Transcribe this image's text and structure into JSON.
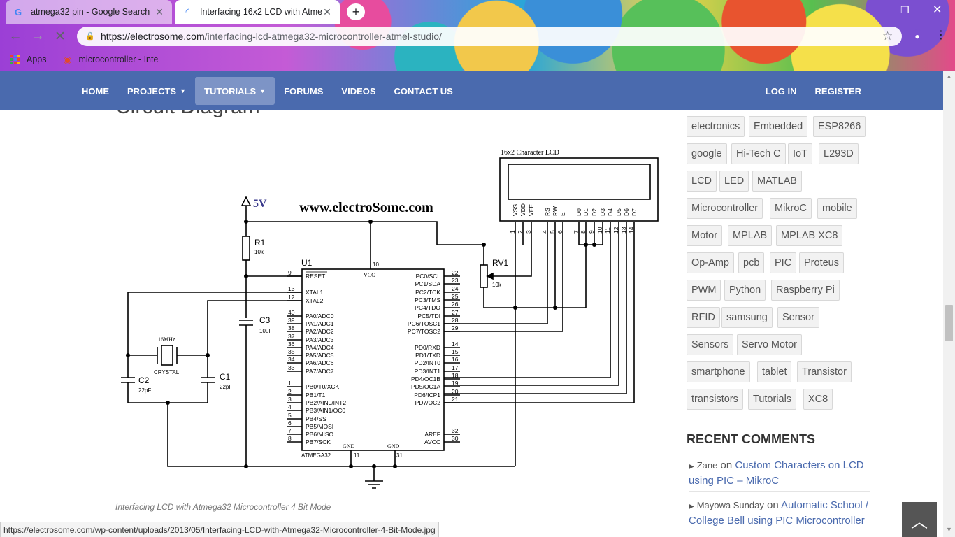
{
  "browser": {
    "tabs": [
      {
        "title": "atmega32 pin - Google Search",
        "favicon": "google-g-icon"
      },
      {
        "title": "Interfacing 16x2 LCD with Atmeg",
        "favicon": "loading-icon"
      }
    ],
    "new_tab": "+",
    "url_host": "https://electrosome.com",
    "url_path": "/interfacing-lcd-atmega32-microcontroller-atmel-studio/",
    "bookmarks": [
      {
        "label": "Apps",
        "icon": "apps-grid-icon"
      },
      {
        "label": "microcontroller - Inte",
        "icon": "site-favicon"
      }
    ],
    "status_url": "https://electrosome.com/wp-content/uploads/2013/05/Interfacing-LCD-with-Atmega32-Microcontroller-4-Bit-Mode.jpg",
    "profile_initial": "●"
  },
  "nav": {
    "items": [
      {
        "label": "HOME"
      },
      {
        "label": "PROJECTS",
        "caret": "▼"
      },
      {
        "label": "TUTORIALS",
        "caret": "▼",
        "active": true
      },
      {
        "label": "FORUMS"
      },
      {
        "label": "VIDEOS"
      },
      {
        "label": "CONTACT US"
      }
    ],
    "right": [
      {
        "label": "LOG IN"
      },
      {
        "label": "REGISTER"
      }
    ]
  },
  "content": {
    "title": "Circuit Diagram",
    "caption": "Interfacing LCD with Atmega32 Microcontroller 4 Bit Mode"
  },
  "diagram": {
    "lcd_label": "16x2 Character LCD",
    "watermark": "www.electroSome.com",
    "vcc_label": "5V",
    "lcd_pins": [
      "VSS",
      "VDD",
      "VEE",
      "RS",
      "RW",
      "E",
      "D0",
      "D1",
      "D2",
      "D3",
      "D4",
      "D5",
      "D6",
      "D7"
    ],
    "lcd_pin_numbers": [
      "1",
      "2",
      "3",
      "4",
      "5",
      "6",
      "7",
      "8",
      "9",
      "10",
      "11",
      "12",
      "13",
      "14"
    ],
    "r1": "R1",
    "r1_value": "10k",
    "rv1": "RV1",
    "rv1_value": "10k",
    "c3": "C3",
    "c3_value": "10uF",
    "c1": "C1",
    "c1_value": "22pF",
    "c2": "C2",
    "c2_value": "22pF",
    "crystal_freq": "16MHz",
    "crystal": "CRYSTAL",
    "u1": "U1",
    "chip": "ATMEGA32",
    "vcc_pin": "VCC",
    "vcc_pin_num": "10",
    "gnd": "GND",
    "gnd_pin_1": "11",
    "gnd_pin_2": "31",
    "left_pins": [
      {
        "num": "9",
        "name": "RESET"
      },
      {
        "num": "13",
        "name": "XTAL1"
      },
      {
        "num": "12",
        "name": "XTAL2"
      },
      {
        "num": "40",
        "name": "PA0/ADC0"
      },
      {
        "num": "39",
        "name": "PA1/ADC1"
      },
      {
        "num": "38",
        "name": "PA2/ADC2"
      },
      {
        "num": "37",
        "name": "PA3/ADC3"
      },
      {
        "num": "36",
        "name": "PA4/ADC4"
      },
      {
        "num": "35",
        "name": "PA5/ADC5"
      },
      {
        "num": "34",
        "name": "PA6/ADC6"
      },
      {
        "num": "33",
        "name": "PA7/ADC7"
      },
      {
        "num": "1",
        "name": "PB0/T0/XCK"
      },
      {
        "num": "2",
        "name": "PB1/T1"
      },
      {
        "num": "3",
        "name": "PB2/AIN0/INT2"
      },
      {
        "num": "4",
        "name": "PB3/AIN1/OC0"
      },
      {
        "num": "5",
        "name": "PB4/SS"
      },
      {
        "num": "6",
        "name": "PB5/MOSI"
      },
      {
        "num": "7",
        "name": "PB6/MISO"
      },
      {
        "num": "8",
        "name": "PB7/SCK"
      }
    ],
    "right_pins": [
      {
        "num": "22",
        "name": "PC0/SCL"
      },
      {
        "num": "23",
        "name": "PC1/SDA"
      },
      {
        "num": "24",
        "name": "PC2/TCK"
      },
      {
        "num": "25",
        "name": "PC3/TMS"
      },
      {
        "num": "26",
        "name": "PC4/TDO"
      },
      {
        "num": "27",
        "name": "PC5/TDI"
      },
      {
        "num": "28",
        "name": "PC6/TOSC1"
      },
      {
        "num": "29",
        "name": "PC7/TOSC2"
      },
      {
        "num": "14",
        "name": "PD0/RXD"
      },
      {
        "num": "15",
        "name": "PD1/TXD"
      },
      {
        "num": "16",
        "name": "PD2/INT0"
      },
      {
        "num": "17",
        "name": "PD3/INT1"
      },
      {
        "num": "18",
        "name": "PD4/OC1B"
      },
      {
        "num": "19",
        "name": "PD5/OC1A"
      },
      {
        "num": "20",
        "name": "PD6/ICP1"
      },
      {
        "num": "21",
        "name": "PD7/OC2"
      },
      {
        "num": "32",
        "name": "AREF"
      },
      {
        "num": "30",
        "name": "AVCC"
      }
    ]
  },
  "sidebar": {
    "tags": [
      "electronics",
      "Embedded",
      "ESP8266",
      "google",
      "Hi-Tech C",
      "IoT",
      "L293D",
      "LCD",
      "LED",
      "MATLAB",
      "Microcontroller",
      "MikroC",
      "mobile",
      "Motor",
      "MPLAB",
      "MPLAB XC8",
      "Op-Amp",
      "pcb",
      "PIC",
      "Proteus",
      "PWM",
      "Python",
      "Raspberry Pi",
      "RFID",
      "samsung",
      "Sensor",
      "Sensors",
      "Servo Motor",
      "smartphone",
      "tablet",
      "Transistor",
      "transistors",
      "Tutorials",
      "XC8"
    ],
    "recent_heading": "RECENT COMMENTS",
    "comments": [
      {
        "author": "Zane",
        "on": "on",
        "post": "Custom Characters on LCD using PIC – MikroC"
      },
      {
        "author": "Mayowa Sunday",
        "on": "on",
        "post": "Automatic School / College Bell using PIC Microcontroller"
      }
    ]
  }
}
